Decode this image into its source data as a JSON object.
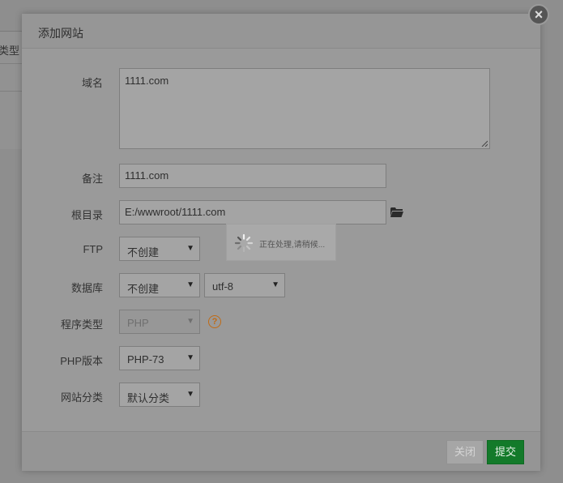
{
  "background": {
    "partial_label": "类型"
  },
  "modal": {
    "title": "添加网站",
    "domain": {
      "label": "域名",
      "value": "1111.com"
    },
    "remark": {
      "label": "备注",
      "value": "1111.com"
    },
    "root_dir": {
      "label": "根目录",
      "value": "E:/wwwroot/1111.com",
      "icon": "folder-open-icon"
    },
    "ftp": {
      "label": "FTP",
      "value": "不创建"
    },
    "database": {
      "label": "数据库",
      "value": "不创建",
      "charset": "utf-8"
    },
    "program_type": {
      "label": "程序类型",
      "value": "PHP",
      "help": "?"
    },
    "php_version": {
      "label": "PHP版本",
      "value": "PHP-73"
    },
    "category": {
      "label": "网站分类",
      "value": "默认分类"
    },
    "footer": {
      "close_label": "关闭",
      "submit_label": "提交"
    },
    "loading": {
      "text": "正在处理,请稍候..."
    }
  },
  "colors": {
    "submit": "#137a2a",
    "help": "#c06a14",
    "overlay": "#8c8c8c"
  }
}
